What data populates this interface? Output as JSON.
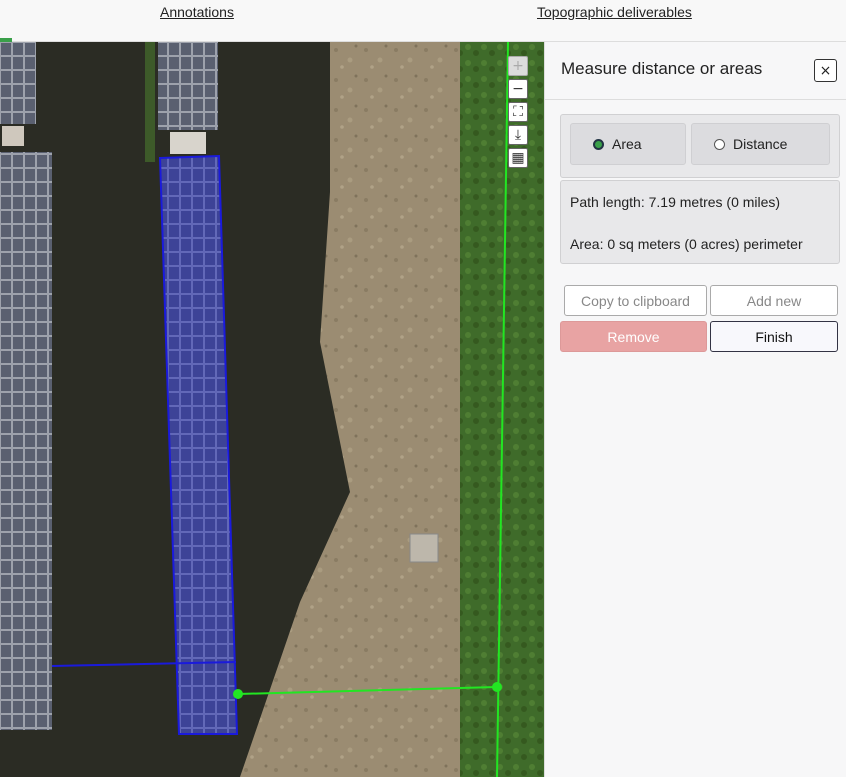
{
  "topbar": {
    "tabs": [
      {
        "label": "Annotations"
      },
      {
        "label": "Topographic deliverables"
      }
    ]
  },
  "map": {
    "controls": [
      {
        "icon": "zoom-in-icon",
        "glyph": "+"
      },
      {
        "icon": "zoom-out-icon",
        "glyph": "−"
      },
      {
        "icon": "fullscreen-icon",
        "glyph": "⛶"
      },
      {
        "icon": "download-icon",
        "glyph": "⤓"
      },
      {
        "icon": "layers-icon",
        "glyph": "▦"
      }
    ],
    "colors": {
      "area_polygon": "#1a1adc",
      "distance_line": "#22e622"
    }
  },
  "panel": {
    "title": "Measure distance or areas",
    "close_glyph": "×",
    "modes": [
      {
        "label": "Area",
        "selected": true
      },
      {
        "label": "Distance",
        "selected": false
      }
    ],
    "path_length": "Path length:   7.19 metres (0 miles)",
    "area": "Area:   0 sq meters (0 acres) perimeter",
    "buttons": {
      "copy": "Copy to clipboard",
      "add_new": "Add new",
      "remove": "Remove",
      "finish": "Finish"
    }
  }
}
